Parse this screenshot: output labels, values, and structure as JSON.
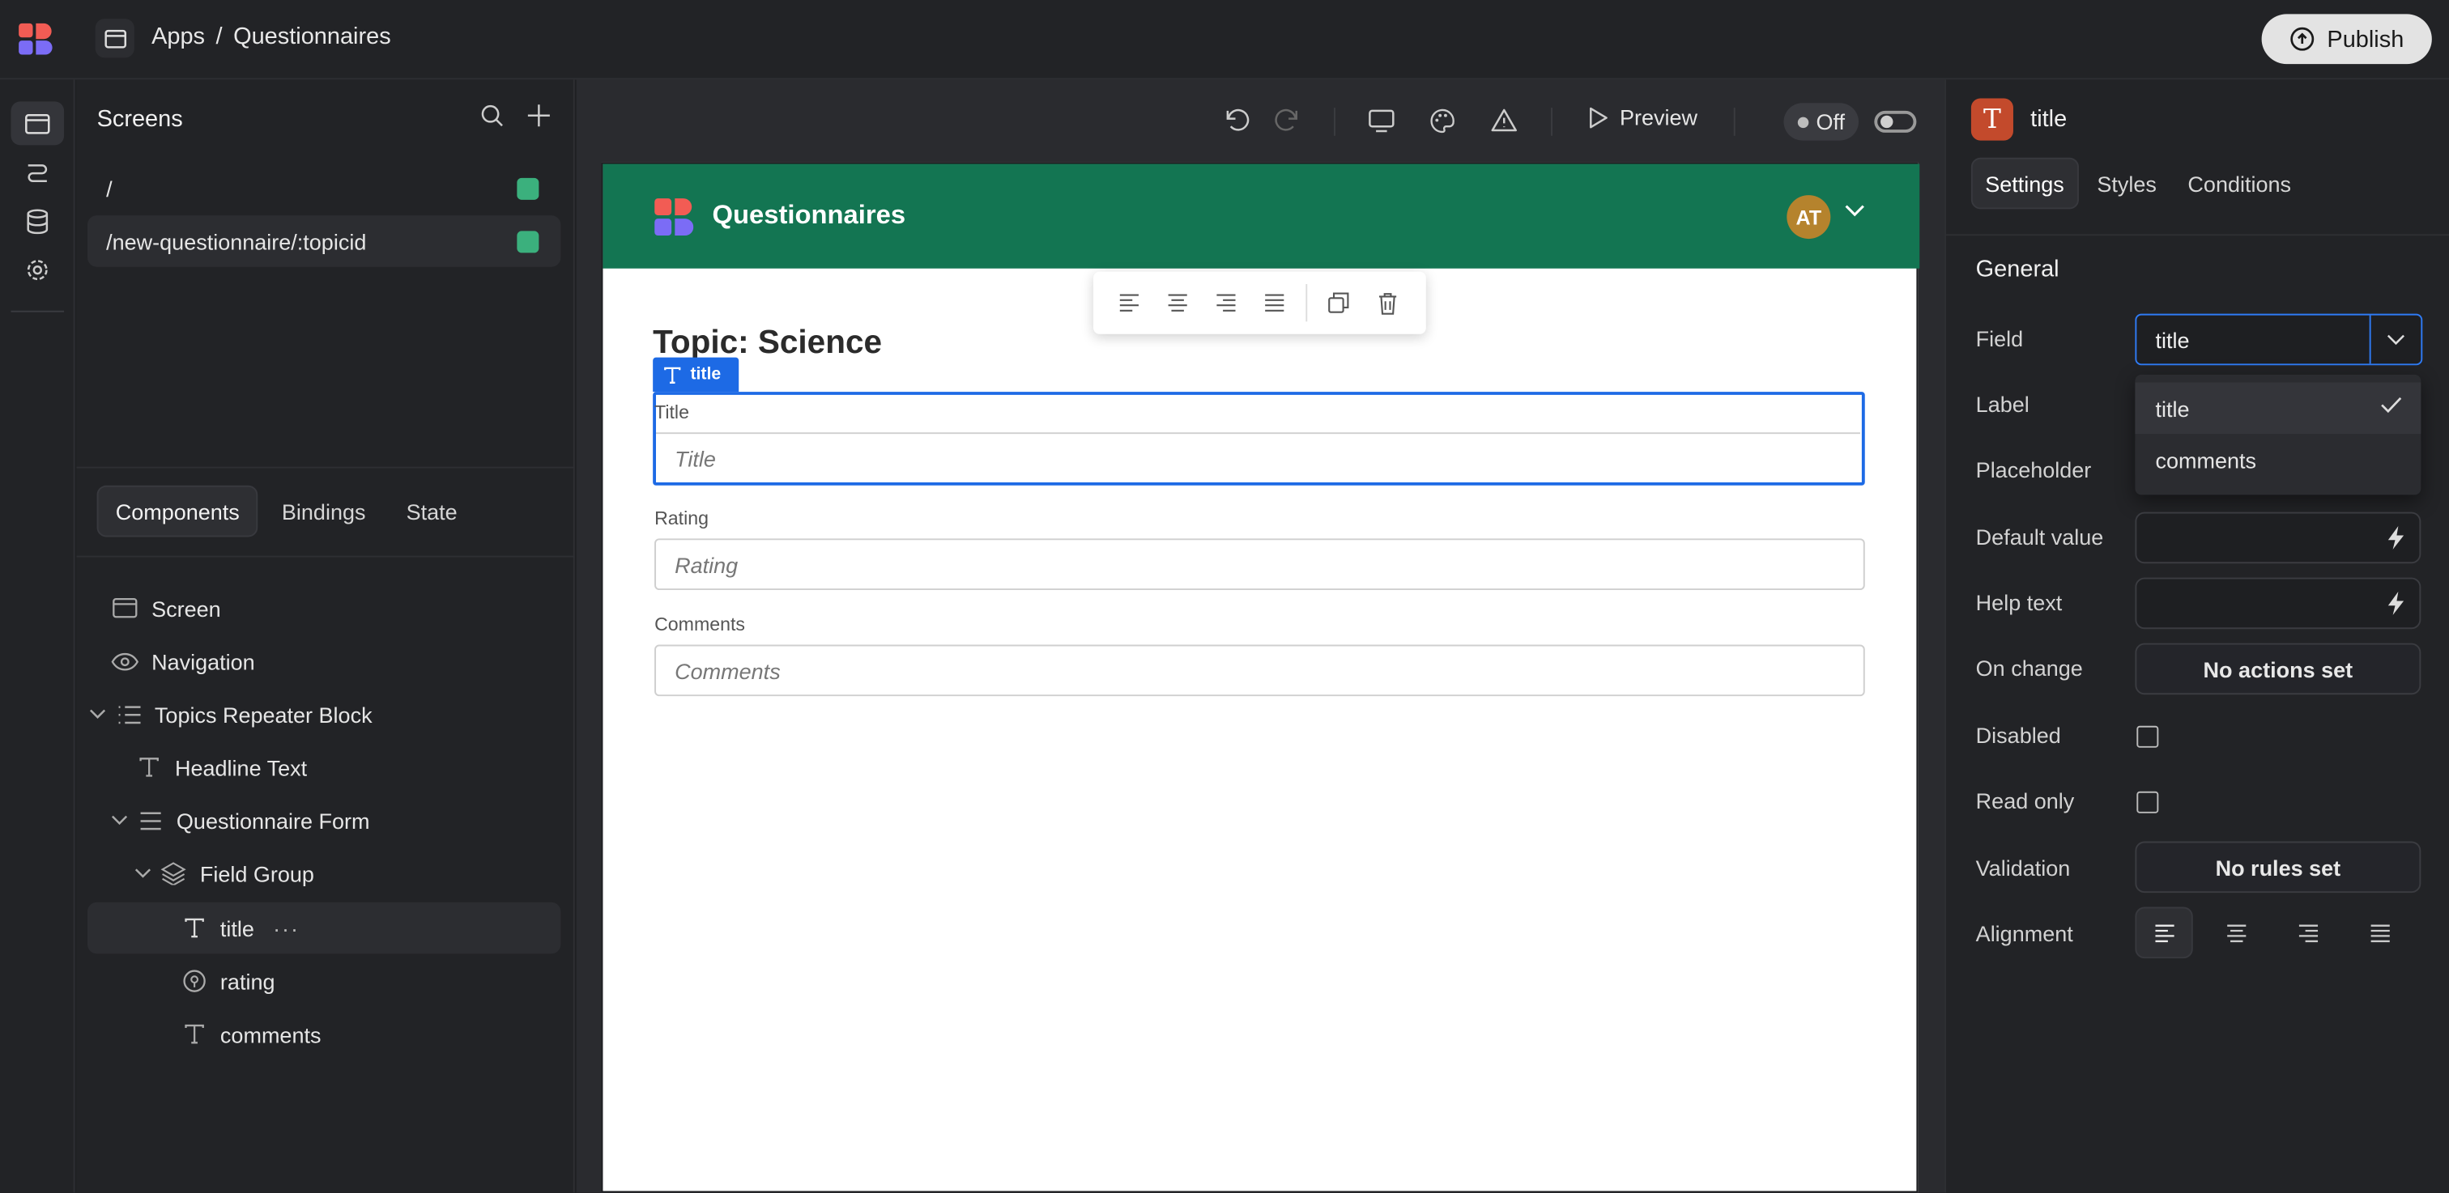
{
  "topbar": {
    "breadcrumb": [
      "Apps",
      "/",
      "Questionnaires"
    ],
    "publish_label": "Publish"
  },
  "screens": {
    "title": "Screens",
    "routes": [
      {
        "path": "/"
      },
      {
        "path": "/new-questionnaire/:topicid"
      }
    ]
  },
  "left_tabs": {
    "components": "Components",
    "bindings": "Bindings",
    "state": "State"
  },
  "tree": [
    {
      "label": "Screen",
      "icon": "screen-icon"
    },
    {
      "label": "Navigation",
      "icon": "eye-icon"
    },
    {
      "label": "Topics Repeater Block",
      "icon": "list-icon"
    },
    {
      "label": "Headline Text",
      "icon": "text-icon"
    },
    {
      "label": "Questionnaire Form",
      "icon": "form-icon"
    },
    {
      "label": "Field Group",
      "icon": "layers-icon"
    },
    {
      "label": "title",
      "icon": "text-icon"
    },
    {
      "label": "rating",
      "icon": "rating-icon"
    },
    {
      "label": "comments",
      "icon": "text-icon"
    }
  ],
  "canvas_toolbar": {
    "preview_label": "Preview",
    "off_label": "Off"
  },
  "app": {
    "title": "Questionnaires",
    "avatar_initials": "AT",
    "topic_heading": "Topic: Science",
    "selected_tag": "title",
    "fields": [
      {
        "label": "Title",
        "placeholder": "Title"
      },
      {
        "label": "Rating",
        "placeholder": "Rating"
      },
      {
        "label": "Comments",
        "placeholder": "Comments"
      }
    ]
  },
  "settings": {
    "component_name": "title",
    "tabs": [
      "Settings",
      "Styles",
      "Conditions"
    ],
    "section": "General",
    "labels": {
      "field": "Field",
      "label": "Label",
      "placeholder": "Placeholder",
      "default_value": "Default value",
      "help_text": "Help text",
      "on_change": "On change",
      "disabled": "Disabled",
      "read_only": "Read only",
      "validation": "Validation",
      "alignment": "Alignment"
    },
    "field_value": "title",
    "field_options": [
      "title",
      "comments"
    ],
    "on_change_value": "No actions set",
    "validation_value": "No rules set"
  },
  "colors": {
    "app_header": "#137552",
    "selection": "#1d6ae5",
    "route_dot": "#3bb07d",
    "component_badge": "#c34a2c",
    "avatar": "#b5832d"
  }
}
